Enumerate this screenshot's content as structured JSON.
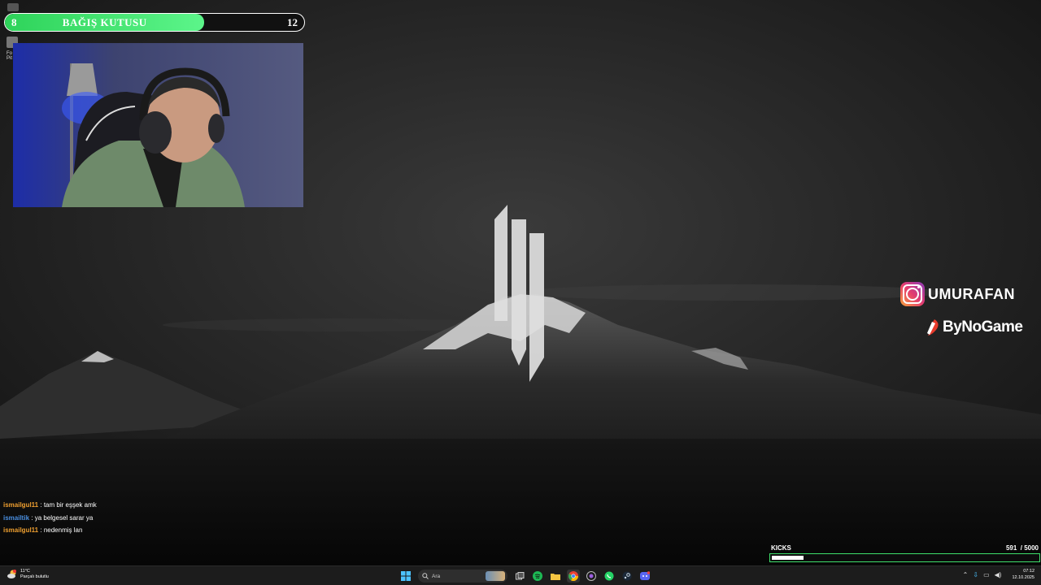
{
  "donation": {
    "title": "BAĞIŞ KUTUSU",
    "current": "8",
    "goal": "12",
    "progress": 0.667
  },
  "desktop_icons": [
    {
      "label": "Fo…\nPit…",
      "icon": "app-icon"
    }
  ],
  "socials": {
    "instagram_handle": "UMURAFAN",
    "sponsor": "ByNoGame"
  },
  "chat": [
    {
      "user": "ismailgul11",
      "color": "#f0a030",
      "message": ": tam bir eşşek amk"
    },
    {
      "user": "ismailtik",
      "color": "#4a90e2",
      "message": ": ya belgesel sarar ya"
    },
    {
      "user": "ismailgul11",
      "color": "#f0a030",
      "message": ": nedenmiş lan"
    }
  ],
  "kicks": {
    "label": "KICKS",
    "current": "591",
    "goal": "/ 5000",
    "progress": 0.1182
  },
  "taskbar": {
    "weather_temp": "11°C",
    "weather_desc": "Parçalı bulutlu",
    "search_placeholder": "Ara",
    "apps": [
      "windows-start-icon",
      "search-icon",
      "task-view-icon",
      "spotify-icon",
      "file-explorer-icon",
      "chrome-icon",
      "github-desktop-icon",
      "whatsapp-icon",
      "steam-icon",
      "discord-icon"
    ],
    "time": "07:12",
    "date": "12.10.2025"
  },
  "colors": {
    "donation_fill": "#2ed35a",
    "kicks_border": "#3ee06b"
  }
}
